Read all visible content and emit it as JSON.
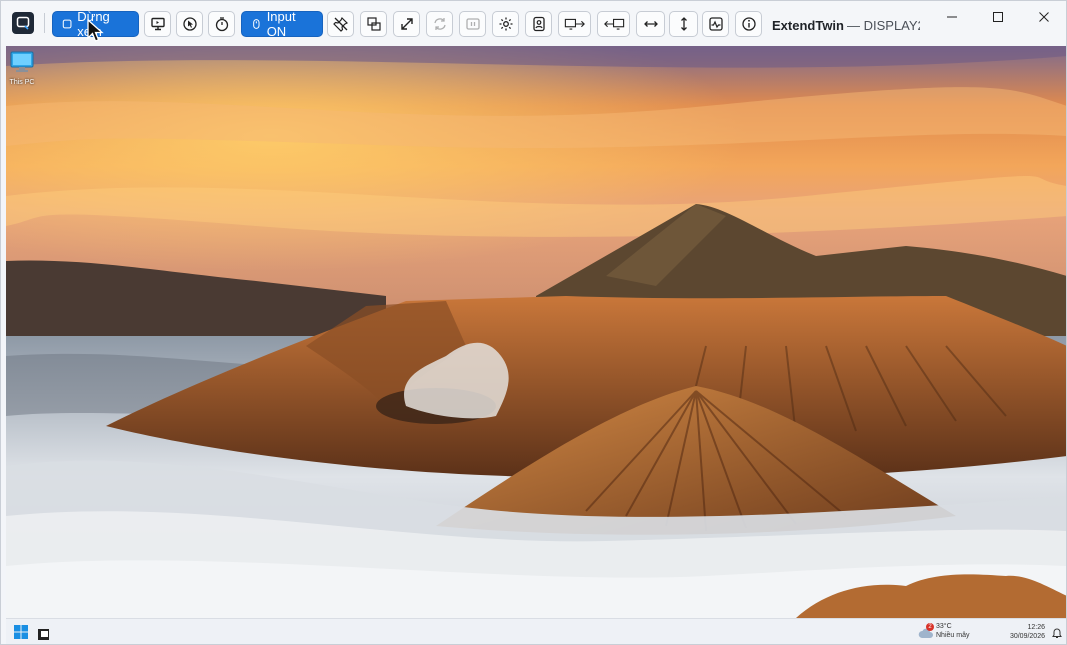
{
  "toolbar": {
    "stop_view_label": "Dừng xem",
    "input_label": "Input ON",
    "icons": [
      "monitor-icon",
      "pointer-icon",
      "timer-icon",
      "mouse-icon",
      "pin-off-icon",
      "window-swap-icon",
      "expand-icon",
      "rotate-icon",
      "pause-icon",
      "settings-icon",
      "portrait-icon",
      "extend-right-icon",
      "extend-left-icon",
      "width-arrows-icon",
      "height-arrows-icon",
      "activity-icon",
      "info-icon"
    ]
  },
  "window": {
    "app_name": "ExtendTwin",
    "display_name": "— DISPLAY2",
    "controls": [
      "minimize",
      "maximize",
      "close"
    ]
  },
  "desktop": {
    "icon_label": "This PC"
  },
  "taskbar": {
    "weather_badge": "2",
    "weather_temp": "33°C",
    "weather_desc": "Nhiều mây",
    "time": "12:26",
    "date": "30/09/2026"
  }
}
